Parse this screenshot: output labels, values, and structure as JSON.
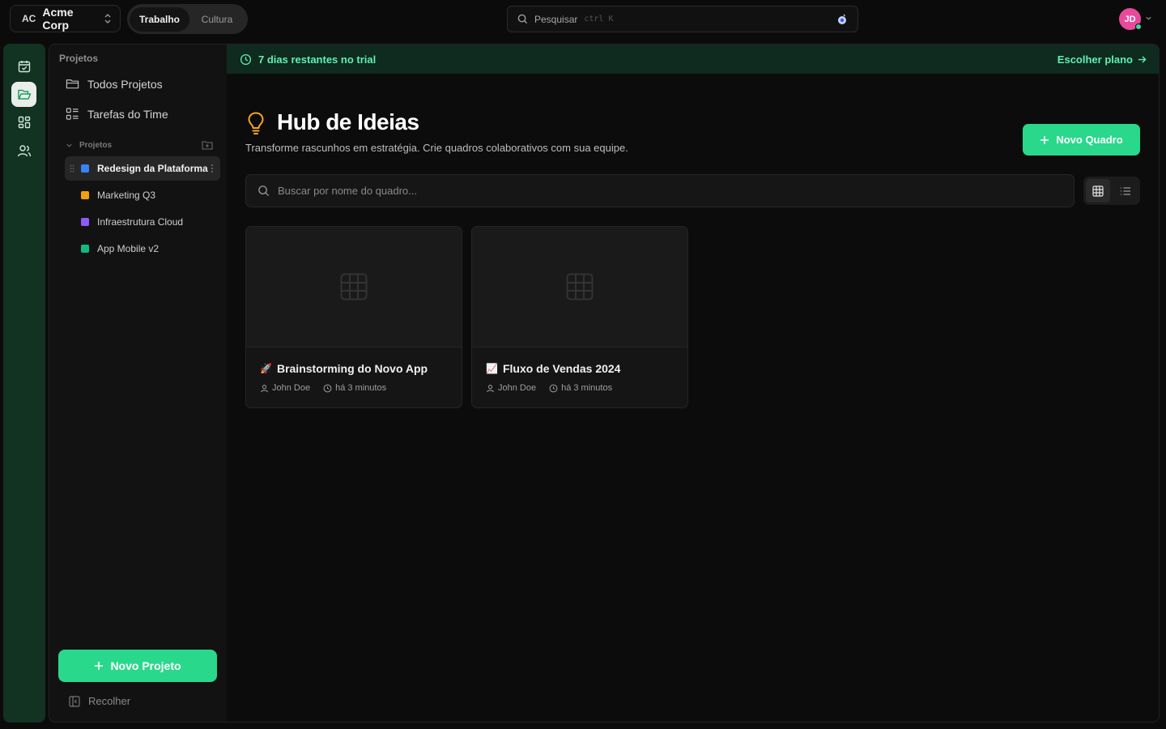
{
  "workspace": {
    "abbr": "AC",
    "name": "Acme Corp"
  },
  "mode_tabs": [
    {
      "label": "Trabalho",
      "active": true
    },
    {
      "label": "Cultura",
      "active": false
    }
  ],
  "search": {
    "label": "Pesquisar",
    "shortcut": "ctrl K"
  },
  "user": {
    "initials": "JD",
    "avatar_color": "#e84a9b",
    "status_color": "#3ddc97"
  },
  "rail": {
    "items": [
      "calendar-icon",
      "folder-open-icon",
      "grid-icon",
      "users-icon"
    ],
    "active": "folder-open-icon",
    "bg": "#123222"
  },
  "sidebar": {
    "title": "Projetos",
    "nav": [
      {
        "label": "Todos Projetos",
        "icon": "folder-icon"
      },
      {
        "label": "Tarefas do Time",
        "icon": "tasks-icon"
      }
    ],
    "section_label": "Projetos",
    "projects": [
      {
        "label": "Redesign da Plataforma",
        "color": "#3b82f6",
        "active": true
      },
      {
        "label": "Marketing Q3",
        "color": "#f59e0b",
        "active": false
      },
      {
        "label": "Infraestrutura Cloud",
        "color": "#8b5cf6",
        "active": false
      },
      {
        "label": "App Mobile v2",
        "color": "#10b981",
        "active": false
      }
    ],
    "new_project_label": "Novo Projeto",
    "collapse_label": "Recolher"
  },
  "trial": {
    "message": "7 dias restantes no trial",
    "cta": "Escolher plano"
  },
  "hub": {
    "title": "Hub de Ideias",
    "subtitle": "Transforme rascunhos em estratégia. Crie quadros colaborativos com sua equipe.",
    "new_board_label": "Novo Quadro",
    "search_placeholder": "Buscar por nome do quadro...",
    "view_mode": "grid"
  },
  "boards": [
    {
      "emoji": "🚀",
      "title": "Brainstorming do Novo App",
      "author": "John Doe",
      "time": "há 3 minutos"
    },
    {
      "emoji": "📈",
      "title": "Fluxo de Vendas 2024",
      "author": "John Doe",
      "time": "há 3 minutos"
    }
  ],
  "colors": {
    "accent": "#2ad88b",
    "trial_text": "#5ff0b1",
    "trial_bg": "#0f2a1f",
    "bulb": "#f5a524"
  }
}
